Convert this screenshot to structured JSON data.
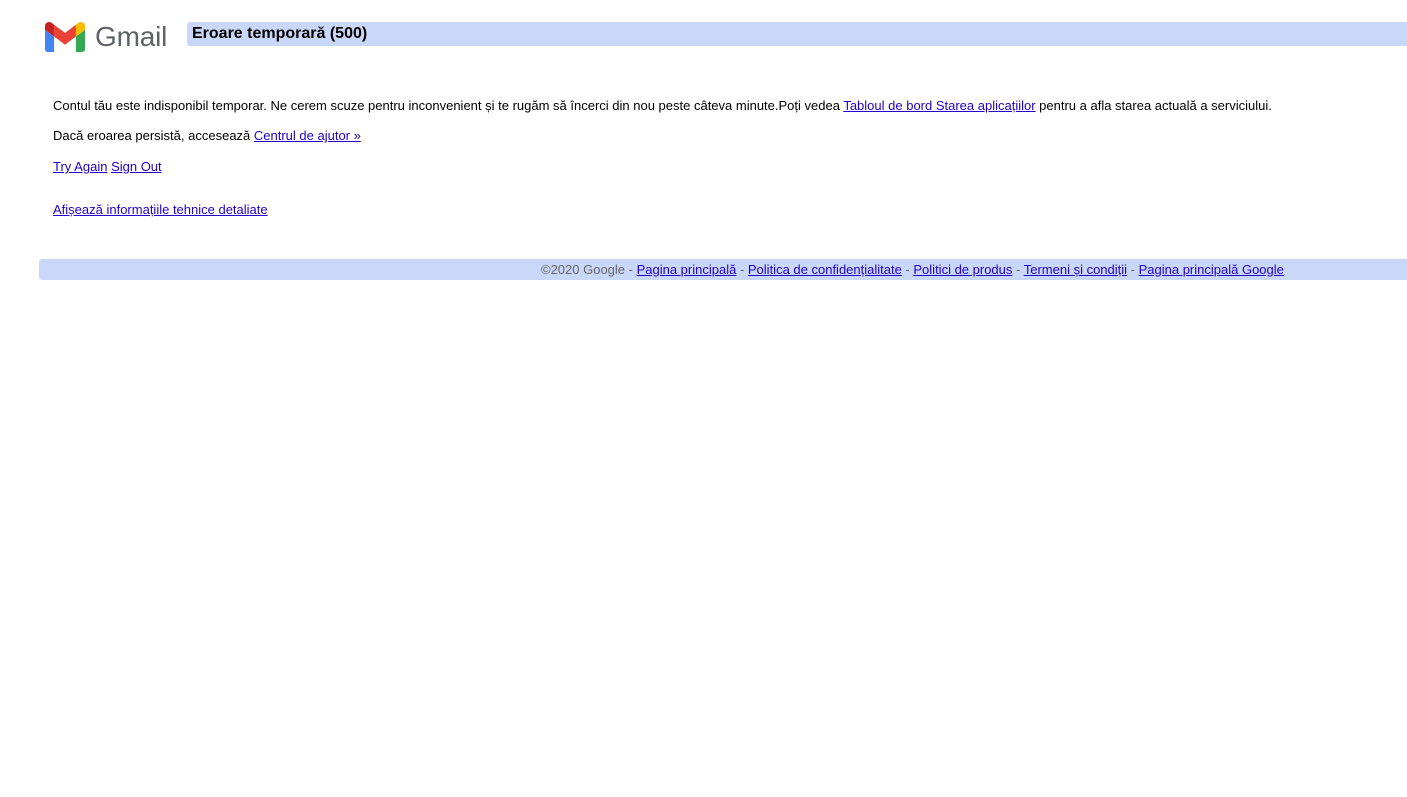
{
  "header": {
    "logo_text": "Gmail",
    "title": "Eroare temporară (500)"
  },
  "message": {
    "line1_text": "Contul tău este indisponibil temporar. Ne cerem scuze pentru inconvenient și te rugăm să încerci din nou peste câteva minute.Poți vedea ",
    "line1_link": "Tabloul de bord Starea aplicațiilor",
    "line1_suffix": " pentru a afla starea actuală a serviciului.",
    "line2_text": "Dacă eroarea persistă, accesează ",
    "line2_link": "Centrul de ajutor »"
  },
  "actions": {
    "try_again": "Try Again",
    "sign_out": "Sign Out",
    "details": "Afișează informațiile tehnice detaliate"
  },
  "footer": {
    "copyright": "©2020 Google - ",
    "links": [
      "Pagina principală",
      "Politica de confidențialitate",
      "Politici de produs",
      "Termeni și condiții",
      "Pagina principală Google"
    ],
    "separator": " - "
  },
  "colors": {
    "bar": "#c9d7f8",
    "link": "#2200cc",
    "gmail_red": "#ea4335",
    "gmail_blue": "#4285f4",
    "gmail_green": "#34a853",
    "gmail_yellow": "#fbbc04",
    "gmail_darkred": "#c5221f"
  }
}
